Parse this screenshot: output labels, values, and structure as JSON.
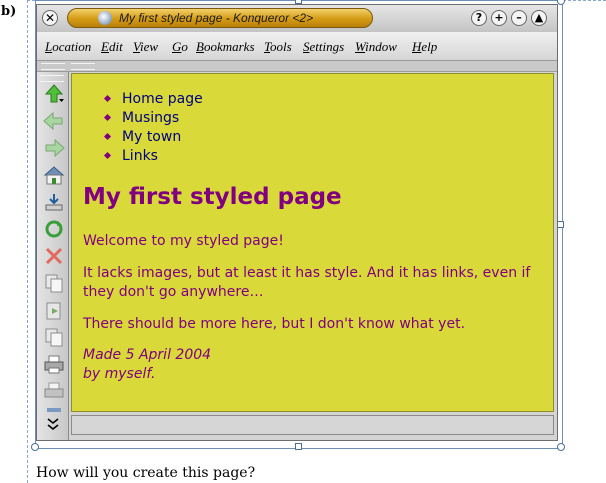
{
  "label": "b)",
  "window": {
    "title": "My first styled page - Konqueror <2>",
    "title_buttons": [
      "?",
      "+",
      "–",
      "▲"
    ]
  },
  "menubar": [
    {
      "u": "L",
      "rest": "ocation"
    },
    {
      "u": "E",
      "rest": "dit"
    },
    {
      "u": "V",
      "rest": "iew"
    },
    {
      "u": "G",
      "rest": "o"
    },
    {
      "u": "B",
      "rest": "ookmarks"
    },
    {
      "u": "T",
      "rest": "ools"
    },
    {
      "u": "S",
      "rest": "ettings"
    },
    {
      "u": "W",
      "rest": "indow"
    },
    {
      "u": "H",
      "rest": "elp"
    }
  ],
  "sidebar_icons": [
    "up-arrow-icon",
    "back-arrow-icon",
    "forward-arrow-icon",
    "home-icon",
    "download-icon",
    "reload-icon",
    "stop-icon",
    "copy-icon",
    "paste-icon",
    "print-icon",
    "print-preview-icon",
    "more-icon"
  ],
  "page": {
    "nav": [
      "Home page",
      "Musings",
      "My town",
      "Links"
    ],
    "heading": "My first styled page",
    "p1": "Welcome to my styled page!",
    "p2": "It lacks images, but at least it has style. And it has links, even if they don't go anywhere…",
    "p3": "There should be more here, but I don't know what yet.",
    "sig_line1": "Made 5 April 2004",
    "sig_line2": "by myself.",
    "colors": {
      "background": "#d9d93a",
      "text": "#800080",
      "link": "#000080"
    }
  },
  "chevron": "»",
  "question": "How will you create this page?"
}
